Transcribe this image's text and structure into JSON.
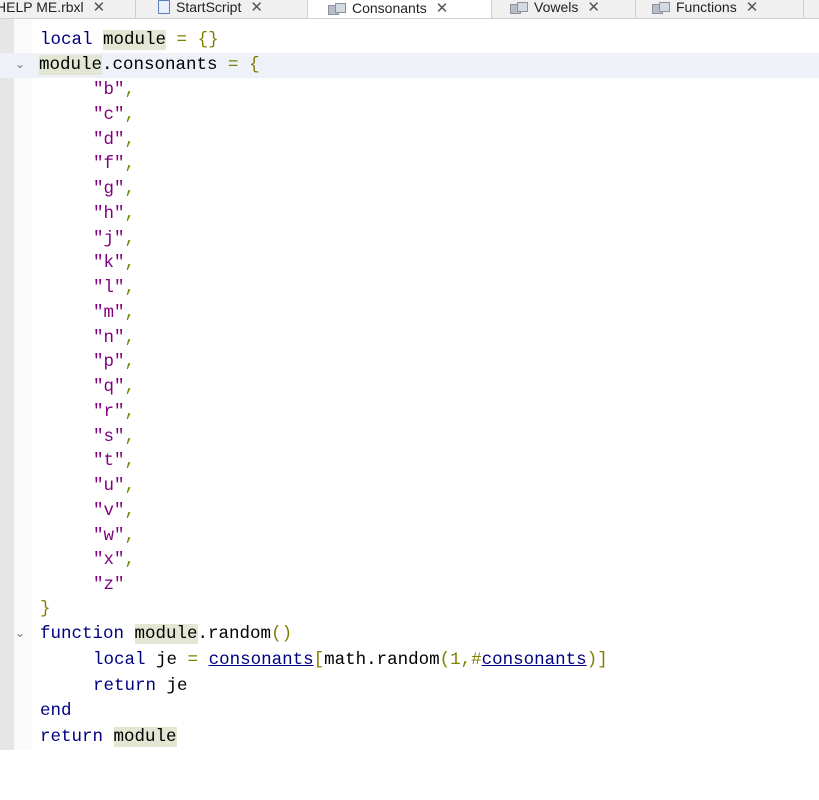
{
  "tabs": [
    {
      "label": "HELP ME.rbxl",
      "icon": "place-file-icon",
      "active": false
    },
    {
      "label": "StartScript",
      "icon": "script-icon",
      "active": false
    },
    {
      "label": "Consonants",
      "icon": "module-script-icon",
      "active": true
    },
    {
      "label": "Vowels",
      "icon": "module-script-icon",
      "active": false
    },
    {
      "label": "Functions",
      "icon": "module-script-icon",
      "active": false
    }
  ],
  "tab_close_glyph": "✕",
  "editor": {
    "code": {
      "l1_local": "local",
      "l1_module": "module",
      "l1_assign": " = ",
      "l1_braces": "{}",
      "l2_module": "module",
      "l2_field": ".consonants",
      "l2_assign": " = ",
      "l2_brace": "{",
      "consonants": [
        "b",
        "c",
        "d",
        "f",
        "g",
        "h",
        "j",
        "k",
        "l",
        "m",
        "n",
        "p",
        "q",
        "r",
        "s",
        "t",
        "u",
        "v",
        "w",
        "x",
        "z"
      ],
      "l24_close": "}",
      "l25_function": "function",
      "l25_module": "module",
      "l25_name": ".random",
      "l25_parens": "()",
      "l26_local": "local",
      "l26_var": " je ",
      "l26_eq": "=",
      "l26_ref": "consonants",
      "l26_open": "[",
      "l26_call": "math.random",
      "l26_args_open": "(1,#",
      "l26_ref2": "consonants",
      "l26_close": ")]",
      "l27_return": "return",
      "l27_var": " je",
      "l28_end": "end",
      "l29_return": "return",
      "l29_module": "module"
    },
    "fold_glyph": "⌄"
  }
}
